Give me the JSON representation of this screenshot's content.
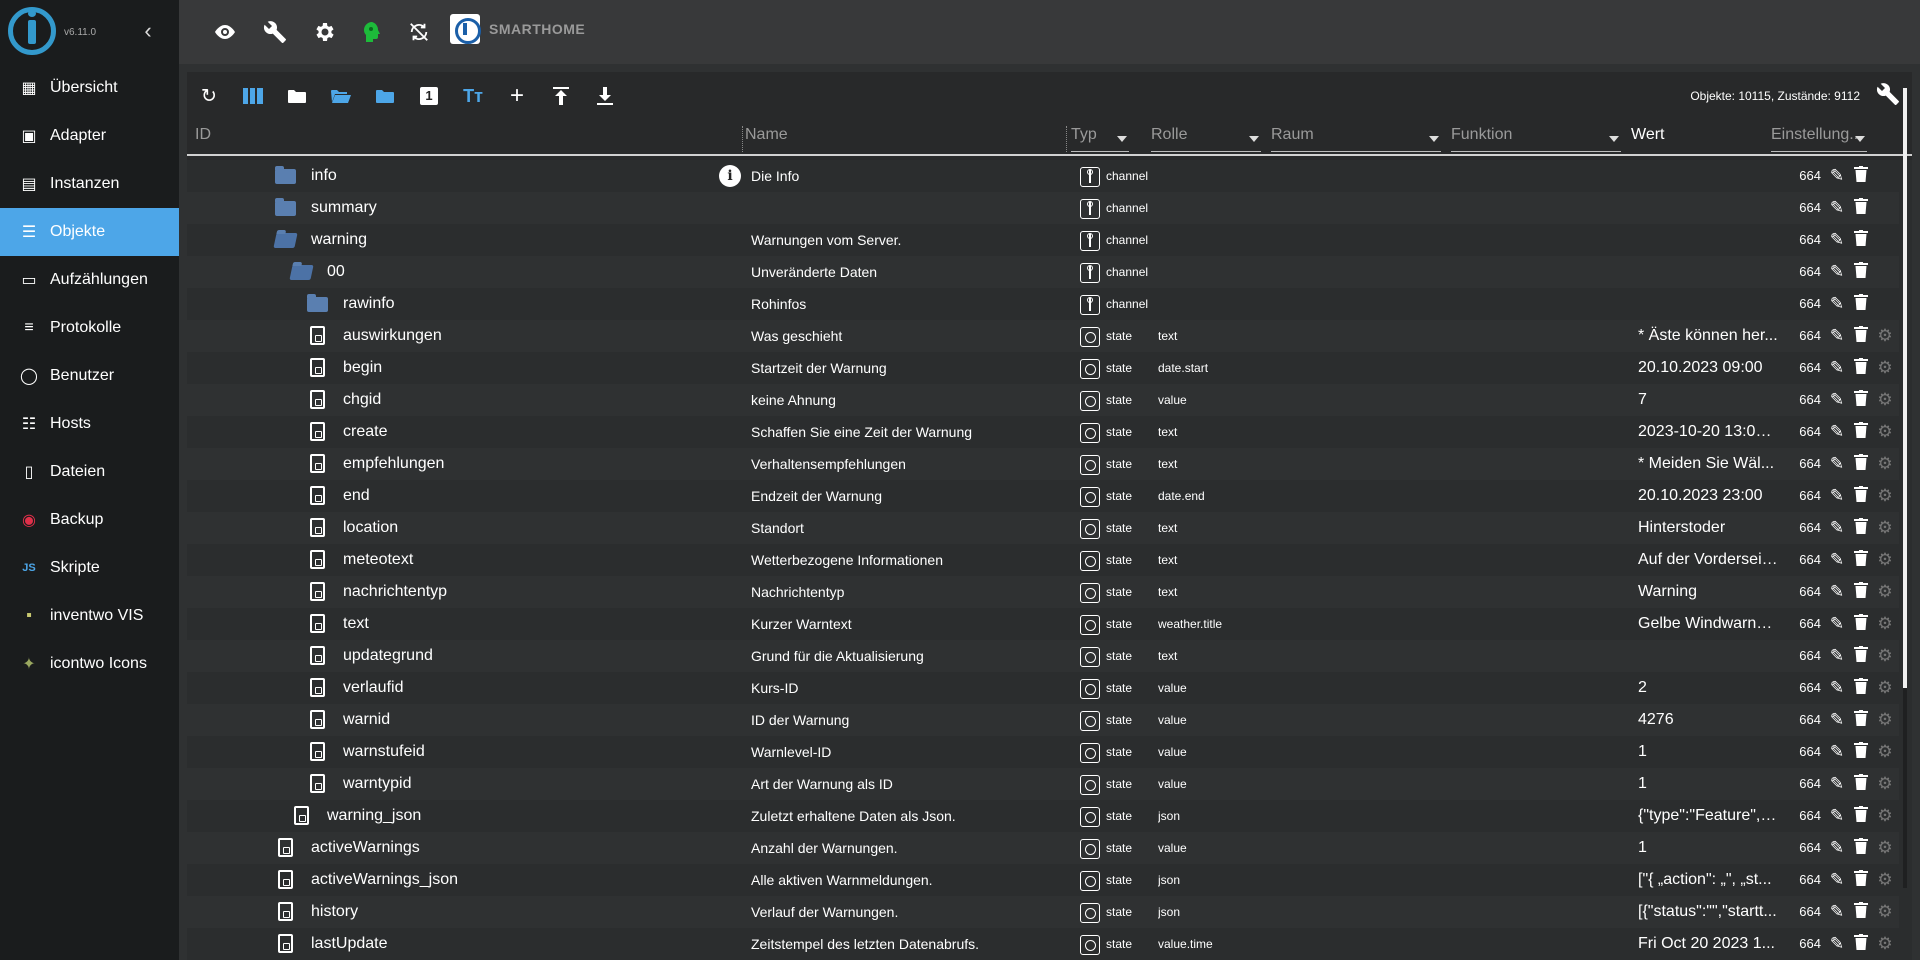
{
  "app": {
    "version": "v6.11.0",
    "brand": "SMARTHOME"
  },
  "sidebar": {
    "items": [
      {
        "label": "Übersicht",
        "icon": "grid-icon",
        "active": false
      },
      {
        "label": "Adapter",
        "icon": "store-icon",
        "active": false
      },
      {
        "label": "Instanzen",
        "icon": "instances-icon",
        "active": false
      },
      {
        "label": "Objekte",
        "icon": "list-icon",
        "active": true
      },
      {
        "label": "Aufzählungen",
        "icon": "enum-icon",
        "active": false
      },
      {
        "label": "Protokolle",
        "icon": "log-icon",
        "active": false
      },
      {
        "label": "Benutzer",
        "icon": "user-icon",
        "active": false
      },
      {
        "label": "Hosts",
        "icon": "hosts-icon",
        "active": false
      },
      {
        "label": "Dateien",
        "icon": "files-icon",
        "active": false
      },
      {
        "label": "Backup",
        "icon": "backup-icon",
        "active": false
      },
      {
        "label": "Skripte",
        "icon": "js-icon",
        "active": false
      },
      {
        "label": "inventwo VIS",
        "icon": "vis-icon",
        "active": false
      },
      {
        "label": "icontwo Icons",
        "icon": "icons-icon",
        "active": false
      }
    ]
  },
  "toolbar": {
    "counts": "Objekte: 10115, Zustände: 9112"
  },
  "columns": {
    "id": "ID",
    "name": "Name",
    "typ": "Typ",
    "rolle": "Rolle",
    "raum": "Raum",
    "funktion": "Funktion",
    "wert": "Wert",
    "settings": "Einstellung..."
  },
  "rows": [
    {
      "id": "info",
      "name": "Die Info",
      "typ": "channel",
      "rolle": "",
      "wert": "",
      "acl": "664",
      "kind": "folder",
      "level": 0,
      "info": true
    },
    {
      "id": "summary",
      "name": "",
      "typ": "channel",
      "rolle": "",
      "wert": "",
      "acl": "664",
      "kind": "folder",
      "level": 0
    },
    {
      "id": "warning",
      "name": "Warnungen vom Server.",
      "typ": "channel",
      "rolle": "",
      "wert": "",
      "acl": "664",
      "kind": "folder-open",
      "level": 0
    },
    {
      "id": "00",
      "name": "Unveränderte Daten",
      "typ": "channel",
      "rolle": "",
      "wert": "",
      "acl": "664",
      "kind": "folder-open",
      "level": 1
    },
    {
      "id": "rawinfo",
      "name": "Rohinfos",
      "typ": "channel",
      "rolle": "",
      "wert": "",
      "acl": "664",
      "kind": "folder",
      "level": 2
    },
    {
      "id": "auswirkungen",
      "name": "Was geschieht",
      "typ": "state",
      "rolle": "text",
      "wert": "* Äste können her...",
      "acl": "664",
      "kind": "file",
      "level": 2
    },
    {
      "id": "begin",
      "name": "Startzeit der Warnung",
      "typ": "state",
      "rolle": "date.start",
      "wert": "20.10.2023 09:00",
      "acl": "664",
      "kind": "file",
      "level": 2
    },
    {
      "id": "chgid",
      "name": "keine Ahnung",
      "typ": "state",
      "rolle": "value",
      "wert": "7",
      "acl": "664",
      "kind": "file",
      "level": 2
    },
    {
      "id": "create",
      "name": "Schaffen Sie eine Zeit der Warnung",
      "typ": "state",
      "rolle": "text",
      "wert": "2023-10-20 13:00:...",
      "acl": "664",
      "kind": "file",
      "level": 2
    },
    {
      "id": "empfehlungen",
      "name": "Verhaltensempfehlungen",
      "typ": "state",
      "rolle": "text",
      "wert": "* Meiden Sie Wäl...",
      "acl": "664",
      "kind": "file",
      "level": 2
    },
    {
      "id": "end",
      "name": "Endzeit der Warnung",
      "typ": "state",
      "rolle": "date.end",
      "wert": "20.10.2023 23:00",
      "acl": "664",
      "kind": "file",
      "level": 2
    },
    {
      "id": "location",
      "name": "Standort",
      "typ": "state",
      "rolle": "text",
      "wert": "Hinterstoder",
      "acl": "664",
      "kind": "file",
      "level": 2
    },
    {
      "id": "meteotext",
      "name": "Wetterbezogene Informationen",
      "typ": "state",
      "rolle": "text",
      "wert": "Auf der Vorderseit...",
      "acl": "664",
      "kind": "file",
      "level": 2
    },
    {
      "id": "nachrichtentyp",
      "name": "Nachrichtentyp",
      "typ": "state",
      "rolle": "text",
      "wert": "Warning",
      "acl": "664",
      "kind": "file",
      "level": 2
    },
    {
      "id": "text",
      "name": "Kurzer Warntext",
      "typ": "state",
      "rolle": "weather.title",
      "wert": "Gelbe Windwarnu...",
      "acl": "664",
      "kind": "file",
      "level": 2
    },
    {
      "id": "updategrund",
      "name": "Grund für die Aktualisierung",
      "typ": "state",
      "rolle": "text",
      "wert": "",
      "acl": "664",
      "kind": "file",
      "level": 2
    },
    {
      "id": "verlaufid",
      "name": "Kurs-ID",
      "typ": "state",
      "rolle": "value",
      "wert": "2",
      "acl": "664",
      "kind": "file",
      "level": 2
    },
    {
      "id": "warnid",
      "name": "ID der Warnung",
      "typ": "state",
      "rolle": "value",
      "wert": "4276",
      "acl": "664",
      "kind": "file",
      "level": 2
    },
    {
      "id": "warnstufeid",
      "name": "Warnlevel-ID",
      "typ": "state",
      "rolle": "value",
      "wert": "1",
      "acl": "664",
      "kind": "file",
      "level": 2
    },
    {
      "id": "warntypid",
      "name": "Art der Warnung als ID",
      "typ": "state",
      "rolle": "value",
      "wert": "1",
      "acl": "664",
      "kind": "file",
      "level": 2
    },
    {
      "id": "warning_json",
      "name": "Zuletzt erhaltene Daten als Json.",
      "typ": "state",
      "rolle": "json",
      "wert": "{\"type\":\"Feature\",\"...",
      "acl": "664",
      "kind": "file",
      "level": 1
    },
    {
      "id": "activeWarnings",
      "name": "Anzahl der Warnungen.",
      "typ": "state",
      "rolle": "value",
      "wert": "1",
      "acl": "664",
      "kind": "file",
      "level": 0
    },
    {
      "id": "activeWarnings_json",
      "name": "Alle aktiven Warnmeldungen.",
      "typ": "state",
      "rolle": "json",
      "wert": "[\"{ „action\": „\", „st...",
      "acl": "664",
      "kind": "file",
      "level": 0
    },
    {
      "id": "history",
      "name": "Verlauf der Warnungen.",
      "typ": "state",
      "rolle": "json",
      "wert": "[{\"status\":\"\",\"startt...",
      "acl": "664",
      "kind": "file",
      "level": 0
    },
    {
      "id": "lastUpdate",
      "name": "Zeitstempel des letzten Datenabrufs.",
      "typ": "state",
      "rolle": "value.time",
      "wert": "Fri Oct 20 2023 1...",
      "acl": "664",
      "kind": "file",
      "level": 0
    }
  ]
}
